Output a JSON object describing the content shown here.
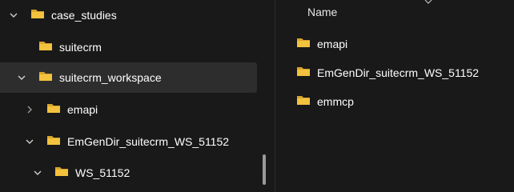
{
  "nav": {
    "items": [
      {
        "label": "case_studies",
        "expanded": true,
        "icon": "chevron-down-icon"
      },
      {
        "label": "suitecrm"
      },
      {
        "label": "suitecrm_workspace",
        "expanded": true,
        "selected": true,
        "icon": "chevron-down-icon"
      },
      {
        "label": "emapi",
        "expanded": false,
        "icon": "chevron-right-icon"
      },
      {
        "label": "EmGenDir_suitecrm_WS_51152",
        "expanded": true,
        "icon": "chevron-down-icon"
      },
      {
        "label": "WS_51152",
        "expanded": true,
        "icon": "chevron-down-icon"
      }
    ]
  },
  "content": {
    "column_header": "Name",
    "files": [
      {
        "name": "emapi"
      },
      {
        "name": "EmGenDir_suitecrm_WS_51152"
      },
      {
        "name": "emmcp"
      }
    ]
  },
  "colors": {
    "background": "#191919",
    "selected_row": "#2d2d2d",
    "folder_yellow": "#f3c23e",
    "folder_dark": "#d9a52b",
    "text": "#ffffff"
  }
}
